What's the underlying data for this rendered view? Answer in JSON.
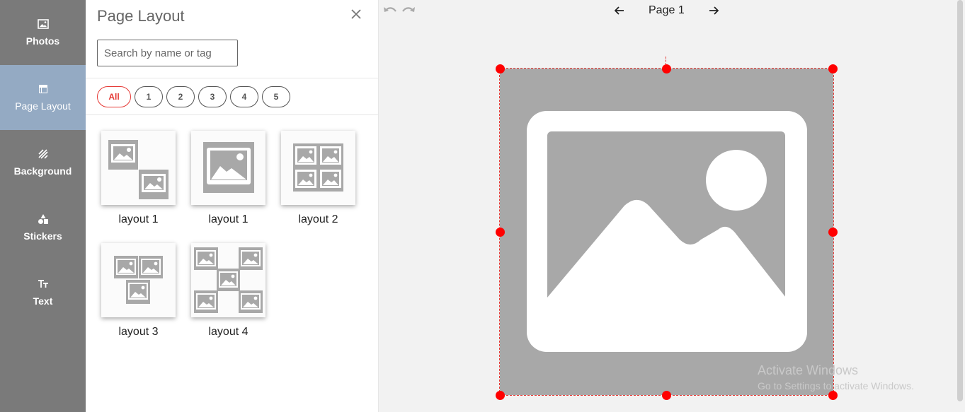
{
  "sidebar": {
    "items": [
      {
        "label": "Photos",
        "icon": "image-icon",
        "active": false
      },
      {
        "label": "Page Layout",
        "icon": "layout-icon",
        "active": true
      },
      {
        "label": "Background",
        "icon": "pattern-icon",
        "active": false
      },
      {
        "label": "Stickers",
        "icon": "shapes-icon",
        "active": false
      },
      {
        "label": "Text",
        "icon": "text-icon",
        "active": false
      }
    ]
  },
  "panel": {
    "title": "Page Layout",
    "search_placeholder": "Search by name or tag",
    "filters": [
      "All",
      "1",
      "2",
      "3",
      "4",
      "5"
    ],
    "active_filter": "All",
    "layouts": [
      {
        "label": "layout 1",
        "variant": "diagonal-two"
      },
      {
        "label": "layout 1",
        "variant": "single"
      },
      {
        "label": "layout 2",
        "variant": "grid-four"
      },
      {
        "label": "layout 3",
        "variant": "three-stack"
      },
      {
        "label": "layout 4",
        "variant": "five-x"
      }
    ]
  },
  "canvas": {
    "page_label": "Page 1",
    "watermark_line1": "Activate Windows",
    "watermark_line2": "Go to Settings to activate Windows."
  },
  "colors": {
    "rail": "#7a7a7a",
    "rail_active": "#94aac3",
    "accent_red": "#e53935",
    "handle": "#ff0000",
    "photo_placeholder": "#a8a8a8"
  }
}
